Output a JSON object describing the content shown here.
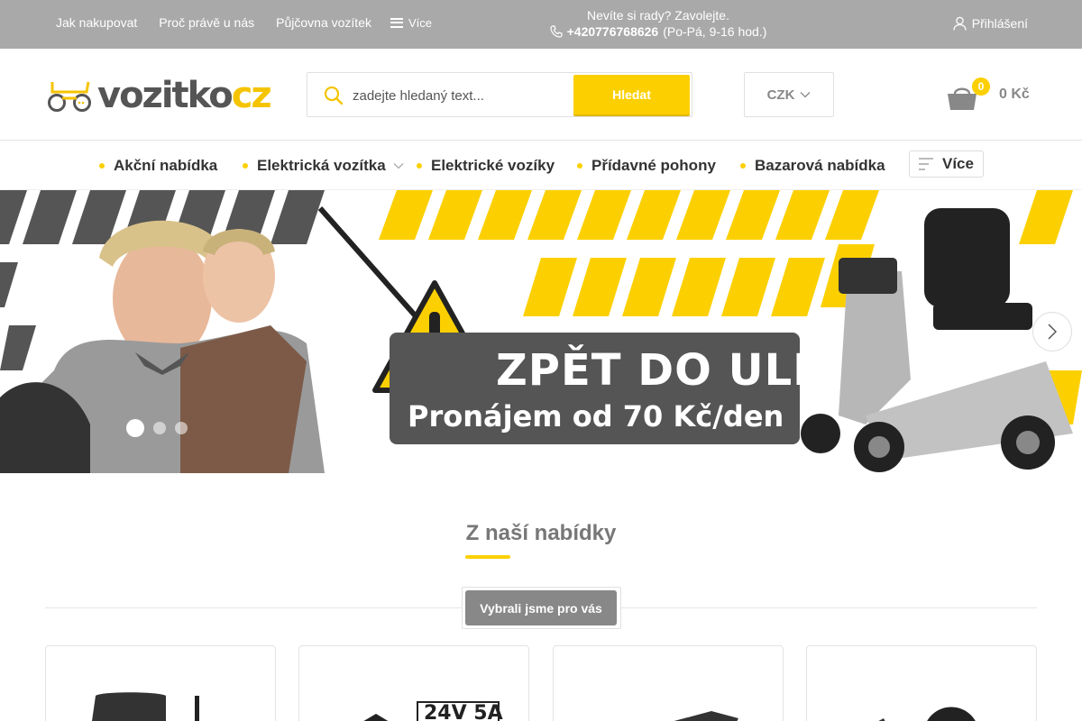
{
  "topbar": {
    "links": [
      "Jak nakupovat",
      "Proč právě u nás",
      "Půjčovna vozítek"
    ],
    "more_label": "Více",
    "contact_text": "Nevíte si rady? Zavolejte.",
    "phone": "+420776768626",
    "hours": "(Po-Pá, 9-16 hod.)",
    "login_label": "Přihlášení"
  },
  "header": {
    "logo_part1": "vozitko",
    "logo_part2": "cz",
    "search_placeholder": "zadejte hledaný text...",
    "search_button": "Hledat",
    "currency": "CZK",
    "cart_count": "0",
    "cart_total": "0 Kč"
  },
  "nav": {
    "items": [
      "Akční nabídka",
      "Elektrická vozítka",
      "Elektrické vozíky",
      "Přídavné pohony",
      "Bazarová nabídka"
    ],
    "more_label": "Více"
  },
  "banner": {
    "headline": "ZPĚT DO ULIC",
    "subline": "Pronájem od  70 Kč/den",
    "slides_total": 3,
    "active_slide": 1
  },
  "offers": {
    "title": "Z naší nabídky",
    "tab_label": "Vybrali jsme pro vás",
    "card_label_2": "24V 5A"
  },
  "colors": {
    "accent": "#fcd000",
    "topbar": "#a9a9a9",
    "dark": "#555555"
  }
}
